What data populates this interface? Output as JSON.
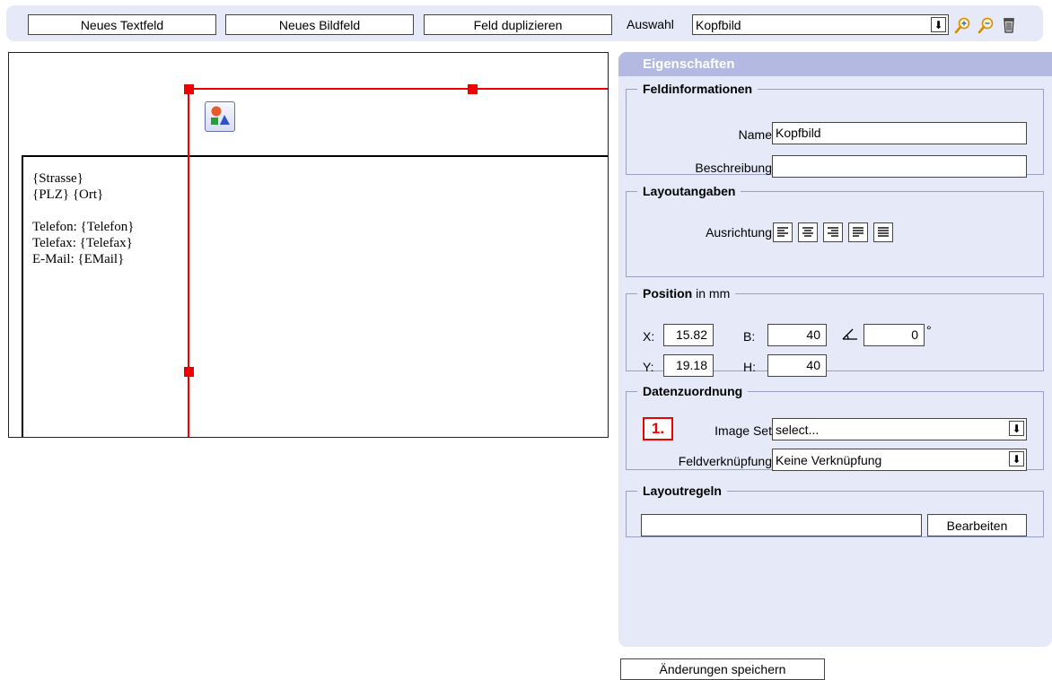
{
  "toolbar": {
    "new_textfield": "Neues Textfeld",
    "new_imagefield": "Neues Bildfeld",
    "duplicate_field": "Feld duplizieren",
    "selection_label": "Auswahl",
    "selection_value": "Kopfbild",
    "icons": [
      "zoom-in-icon",
      "zoom-out-icon",
      "trash-icon"
    ]
  },
  "canvas": {
    "address_lines": [
      "{Strasse}",
      "{PLZ} {Ort}",
      "",
      "Telefon: {Telefon}",
      "Telefax: {Telefax}",
      "E-Mail: {EMail}"
    ]
  },
  "panel": {
    "title": "Eigenschaften",
    "field_info": {
      "legend": "Feldinformationen",
      "name_label": "Name",
      "name_value": "Kopfbild",
      "description_label": "Beschreibung",
      "description_value": ""
    },
    "layout": {
      "legend": "Layoutangaben",
      "alignment_label": "Ausrichtung"
    },
    "position": {
      "legend": "Position",
      "unit": " in mm",
      "x_label": "X:",
      "x_value": "15.82",
      "y_label": "Y:",
      "y_value": "19.18",
      "b_label": "B:",
      "b_value": "40",
      "h_label": "H:",
      "h_value": "40",
      "angle_value": "0",
      "degree_symbol": "°"
    },
    "data_mapping": {
      "legend": "Datenzuordnung",
      "step_badge": "1.",
      "image_set_label": "Image Set",
      "image_set_value": "select...",
      "field_link_label": "Feldverknüpfung",
      "field_link_value": "Keine Verknüpfung"
    },
    "layout_rules": {
      "legend": "Layoutregeln",
      "rule_value": "",
      "edit_button": "Bearbeiten"
    }
  },
  "save_button": "Änderungen speichern"
}
